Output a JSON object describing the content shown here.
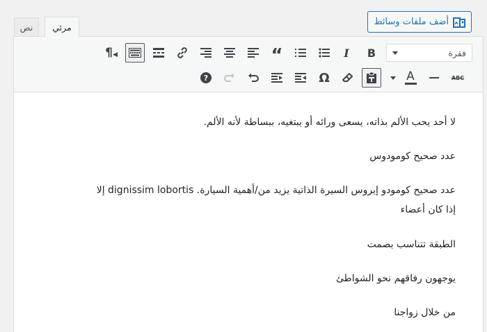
{
  "media_button": {
    "label": "أضف ملفات وسائط",
    "icon": "add-media-icon"
  },
  "tabs": [
    {
      "label": "مرئي",
      "active": true
    },
    {
      "label": "نص",
      "active": false
    }
  ],
  "toolbar": {
    "format_value": "فقرة",
    "row1": [
      "bold-icon",
      "italic-icon",
      "bullet-list-icon",
      "numbered-list-icon",
      "blockquote-icon",
      "align-left-icon",
      "align-center-icon",
      "align-right-icon",
      "link-icon",
      "read-more-icon",
      "toolbar-toggle-icon",
      "paragraph-rtl-icon"
    ],
    "row2": [
      "strikethrough-icon",
      "horizontal-line-icon",
      "text-color-icon",
      "text-color-dropdown-icon",
      "paste-as-text-icon",
      "clear-formatting-icon",
      "special-character-icon",
      "outdent-icon",
      "indent-icon",
      "undo-icon",
      "redo-icon",
      "help-icon"
    ],
    "glyphs": {
      "bold": "B",
      "italic": "I",
      "quote": "“",
      "omega": "Ω",
      "help": "?",
      "abc": "ABC",
      "text_a": "A",
      "pilcrow": "¶"
    }
  },
  "content": {
    "paragraphs": [
      "لا أحد يحب الألم بذاته، يسعى ورائه أو يبتغيه، ببساطة لأنه الألم.",
      "عدد صحيح كومودوس",
      "عدد صحيح كومودو إيروس السيرة الذاتية يزيد من/أهمية السيارة. dignissim lobortis إلا",
      "إذا كان أعضاء",
      "الطبقة تتناسب بصمت",
      "يوجهون رفاقهم نحو الشواطئ",
      "من خلال زواجنا"
    ]
  }
}
